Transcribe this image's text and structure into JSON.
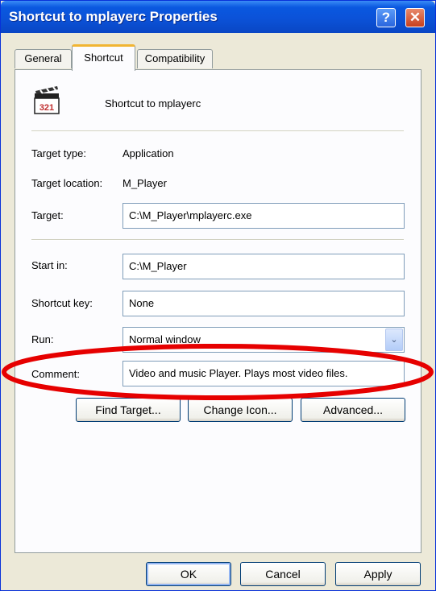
{
  "window": {
    "title": "Shortcut to mplayerc Properties",
    "help_glyph": "?",
    "close_glyph": "✕"
  },
  "tabs": [
    {
      "label": "General"
    },
    {
      "label": "Shortcut"
    },
    {
      "label": "Compatibility"
    }
  ],
  "shortcut": {
    "name": "Shortcut to mplayerc",
    "icon_digits": "321",
    "target_type_label": "Target type:",
    "target_type_value": "Application",
    "target_location_label": "Target location:",
    "target_location_value": "M_Player",
    "target_label": "Target:",
    "target_value": "C:\\M_Player\\mplayerc.exe",
    "start_in_label": "Start in:",
    "start_in_value": "C:\\M_Player",
    "shortcut_key_label": "Shortcut key:",
    "shortcut_key_value": "None",
    "run_label": "Run:",
    "run_value": "Normal window",
    "comment_label": "Comment:",
    "comment_value": "Video and music Player. Plays most video files.",
    "dropdown_glyph": "⌄"
  },
  "buttons": {
    "find_target": "Find Target...",
    "change_icon": "Change Icon...",
    "advanced": "Advanced...",
    "ok": "OK",
    "cancel": "Cancel",
    "apply": "Apply"
  },
  "colors": {
    "highlight": "#e60000",
    "titlebar": "#0a58e0"
  }
}
